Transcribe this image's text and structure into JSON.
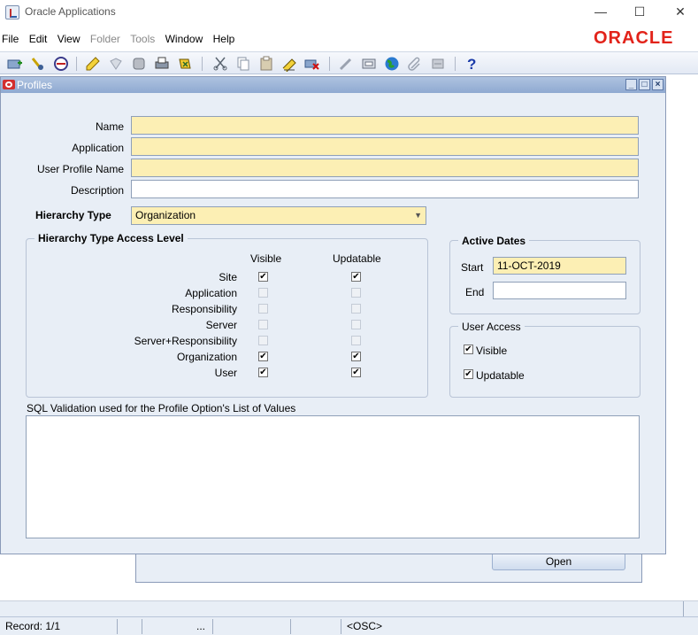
{
  "window": {
    "title": "Oracle Applications",
    "minimize": "—",
    "maximize": "☐",
    "close": "✕"
  },
  "menu": [
    "File",
    "Edit",
    "View",
    "Folder",
    "Tools",
    "Window",
    "Help"
  ],
  "brand": "ORACLE",
  "profiles": {
    "title": "Profiles",
    "labels": {
      "name": "Name",
      "application": "Application",
      "user_profile_name": "User Profile Name",
      "description": "Description",
      "hierarchy_type": "Hierarchy Type"
    },
    "values": {
      "name": "",
      "application": "",
      "user_profile_name": "",
      "description": "",
      "hierarchy_type": "Organization"
    },
    "access_level": {
      "title": "Hierarchy Type Access Level",
      "col_visible": "Visible",
      "col_updatable": "Updatable",
      "rows": [
        {
          "label": "Site",
          "visible": true,
          "updatable": true,
          "enabled": true
        },
        {
          "label": "Application",
          "visible": false,
          "updatable": false,
          "enabled": false
        },
        {
          "label": "Responsibility",
          "visible": false,
          "updatable": false,
          "enabled": false
        },
        {
          "label": "Server",
          "visible": false,
          "updatable": false,
          "enabled": false
        },
        {
          "label": "Server+Responsibility",
          "visible": false,
          "updatable": false,
          "enabled": false
        },
        {
          "label": "Organization",
          "visible": true,
          "updatable": true,
          "enabled": true
        },
        {
          "label": "User",
          "visible": true,
          "updatable": true,
          "enabled": true
        }
      ]
    },
    "active_dates": {
      "title": "Active Dates",
      "start_label": "Start",
      "start_value": "11-OCT-2019",
      "end_label": "End",
      "end_value": ""
    },
    "user_access": {
      "title": "User Access",
      "visible_label": "Visible",
      "visible": true,
      "updatable_label": "Updatable",
      "updatable": true
    },
    "sql_label": "SQL Validation used for the Profile Option's List of Values",
    "sql_value": ""
  },
  "background_window": {
    "open_button": "Open"
  },
  "status": {
    "record": "Record: 1/1",
    "ellipsis": "...",
    "osc": "<OSC>"
  },
  "colors": {
    "required_field": "#fcefb4",
    "brand_red": "#e2231a",
    "window_bg": "#e8eef6"
  }
}
